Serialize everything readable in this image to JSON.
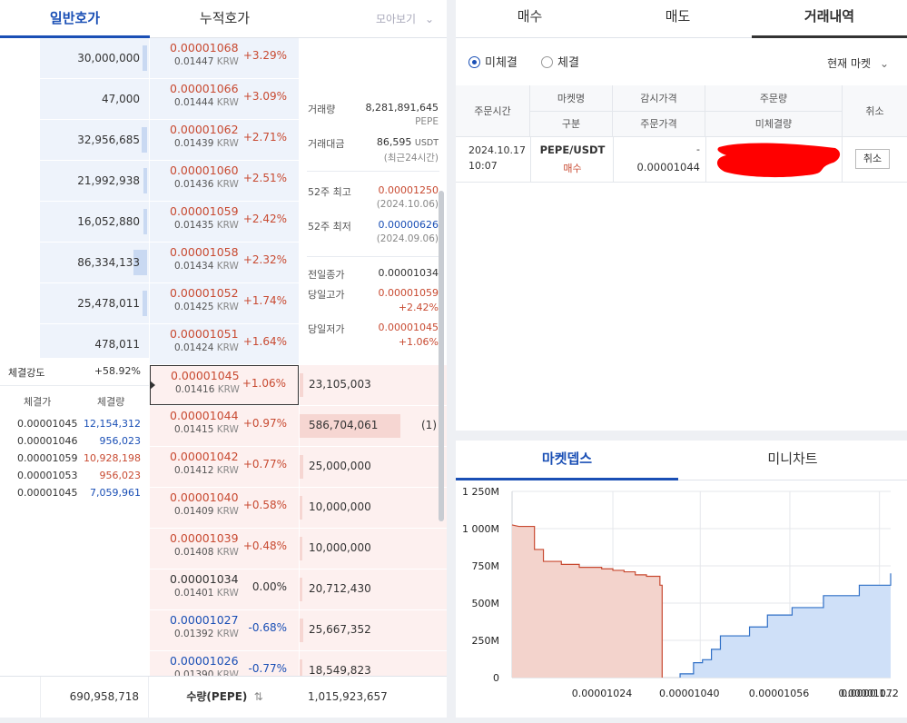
{
  "left_tabs": {
    "normal": "일반호가",
    "cumulative": "누적호가",
    "gather": "모아보기"
  },
  "asks": [
    {
      "vol": "30,000,000",
      "price": "0.00001068",
      "krw": "0.01447",
      "pct": "+3.29%",
      "bar": 0.04
    },
    {
      "vol": "47,000",
      "price": "0.00001066",
      "krw": "0.01444",
      "pct": "+3.09%",
      "bar": 0.0
    },
    {
      "vol": "32,956,685",
      "price": "0.00001062",
      "krw": "0.01439",
      "pct": "+2.71%",
      "bar": 0.05
    },
    {
      "vol": "21,992,938",
      "price": "0.00001060",
      "krw": "0.01436",
      "pct": "+2.51%",
      "bar": 0.03
    },
    {
      "vol": "16,052,880",
      "price": "0.00001059",
      "krw": "0.01435",
      "pct": "+2.42%",
      "bar": 0.03
    },
    {
      "vol": "86,334,133",
      "price": "0.00001058",
      "krw": "0.01434",
      "pct": "+2.32%",
      "bar": 0.13
    },
    {
      "vol": "25,478,011",
      "price": "0.00001052",
      "krw": "0.01425",
      "pct": "+1.74%",
      "bar": 0.04
    },
    {
      "vol": "478,011",
      "price": "0.00001051",
      "krw": "0.01424",
      "pct": "+1.64%",
      "bar": 0.0
    }
  ],
  "bids": [
    {
      "price": "0.00001045",
      "krw": "0.01416",
      "pct": "+1.06%",
      "vol": "23,105,003",
      "bar": 0.04,
      "color": "red",
      "mine": ""
    },
    {
      "price": "0.00001044",
      "krw": "0.01415",
      "pct": "+0.97%",
      "vol": "586,704,061",
      "bar": 1.0,
      "color": "red",
      "mine": "(1)"
    },
    {
      "price": "0.00001042",
      "krw": "0.01412",
      "pct": "+0.77%",
      "vol": "25,000,000",
      "bar": 0.04,
      "color": "red",
      "mine": ""
    },
    {
      "price": "0.00001040",
      "krw": "0.01409",
      "pct": "+0.58%",
      "vol": "10,000,000",
      "bar": 0.02,
      "color": "red",
      "mine": ""
    },
    {
      "price": "0.00001039",
      "krw": "0.01408",
      "pct": "+0.48%",
      "vol": "10,000,000",
      "bar": 0.02,
      "color": "red",
      "mine": ""
    },
    {
      "price": "0.00001034",
      "krw": "0.01401",
      "pct": "0.00%",
      "vol": "20,712,430",
      "bar": 0.03,
      "color": "dark",
      "mine": ""
    },
    {
      "price": "0.00001027",
      "krw": "0.01392",
      "pct": "-0.68%",
      "vol": "25,667,352",
      "bar": 0.04,
      "color": "blue",
      "mine": ""
    },
    {
      "price": "0.00001026",
      "krw": "0.01390",
      "pct": "-0.77%",
      "vol": "18,549,823",
      "bar": 0.03,
      "color": "blue",
      "mine": ""
    }
  ],
  "krw_unit": "KRW",
  "info": {
    "volume_label": "거래량",
    "volume": "8,281,891,645",
    "volume_unit": "PEPE",
    "amount_label": "거래대금",
    "amount": "86,595",
    "amount_unit": "USDT",
    "amount_note": "(최근24시간)",
    "high52_label": "52주 최고",
    "high52": "0.00001250",
    "high52_date": "(2024.10.06)",
    "low52_label": "52주 최저",
    "low52": "0.00000626",
    "low52_date": "(2024.09.06)",
    "prev_close_label": "전일종가",
    "prev_close": "0.00001034",
    "day_high_label": "당일고가",
    "day_high": "0.00001059",
    "day_high_pct": "+2.42%",
    "day_low_label": "당일저가",
    "day_low": "0.00001045",
    "day_low_pct": "+1.06%"
  },
  "trades": {
    "strength_label": "체결강도",
    "strength": "+58.92%",
    "price_header": "체결가",
    "qty_header": "체결량",
    "rows": [
      {
        "price": "0.00001045",
        "qty": "12,154,312",
        "color": "blue"
      },
      {
        "price": "0.00001046",
        "qty": "956,023",
        "color": "blue"
      },
      {
        "price": "0.00001059",
        "qty": "10,928,198",
        "color": "red"
      },
      {
        "price": "0.00001053",
        "qty": "956,023",
        "color": "red"
      },
      {
        "price": "0.00001045",
        "qty": "7,059,961",
        "color": "blue"
      }
    ]
  },
  "footer": {
    "ask_total": "690,958,718",
    "qty_label": "수량(PEPE)",
    "bid_total": "1,015,923,657"
  },
  "order_tabs": {
    "buy": "매수",
    "sell": "매도",
    "history": "거래내역"
  },
  "filters": {
    "unfilled": "미체결",
    "filled": "체결",
    "market": "현재 마켓"
  },
  "order_table": {
    "h_time": "주문시간",
    "h_market": "마켓명",
    "h_type": "구분",
    "h_watch": "감시가격",
    "h_price": "주문가격",
    "h_qty": "주문량",
    "h_unfilled": "미체결량",
    "h_cancel": "취소",
    "row": {
      "date": "2024.10.17",
      "time": "10:07",
      "market": "PEPE/USDT",
      "type": "매수",
      "watch": "-",
      "price": "0.00001044",
      "cancel": "취소"
    }
  },
  "bottom_tabs": {
    "depth": "마켓뎁스",
    "minichart": "미니차트"
  },
  "chart_data": {
    "type": "area",
    "y_ticks": [
      "1 250M",
      "1 000M",
      "750M",
      "500M",
      "250M",
      "0"
    ],
    "x_ticks": [
      "0.00001024",
      "0.00001040",
      "0.00001056",
      "0.00001072",
      "0.0000 1..."
    ],
    "ylim": [
      0,
      1250
    ],
    "bid_series": [
      [
        0,
        1025
      ],
      [
        0.03,
        1015
      ],
      [
        0.1,
        1015
      ],
      [
        0.1,
        860
      ],
      [
        0.14,
        860
      ],
      [
        0.14,
        780
      ],
      [
        0.22,
        780
      ],
      [
        0.22,
        760
      ],
      [
        0.3,
        760
      ],
      [
        0.3,
        740
      ],
      [
        0.4,
        740
      ],
      [
        0.4,
        730
      ],
      [
        0.45,
        730
      ],
      [
        0.45,
        720
      ],
      [
        0.5,
        720
      ],
      [
        0.5,
        710
      ],
      [
        0.55,
        710
      ],
      [
        0.55,
        690
      ],
      [
        0.6,
        690
      ],
      [
        0.6,
        680
      ],
      [
        0.66,
        680
      ],
      [
        0.66,
        620
      ],
      [
        0.67,
        620
      ],
      [
        0.67,
        0
      ]
    ],
    "ask_series": [
      [
        0.75,
        0
      ],
      [
        0.75,
        25
      ],
      [
        0.81,
        25
      ],
      [
        0.81,
        100
      ],
      [
        0.85,
        100
      ],
      [
        0.85,
        120
      ],
      [
        0.89,
        120
      ],
      [
        0.89,
        190
      ],
      [
        0.93,
        190
      ],
      [
        0.93,
        280
      ],
      [
        1.06,
        280
      ],
      [
        1.06,
        340
      ],
      [
        1.14,
        340
      ],
      [
        1.14,
        420
      ],
      [
        1.25,
        420
      ],
      [
        1.25,
        470
      ],
      [
        1.39,
        470
      ],
      [
        1.39,
        550
      ],
      [
        1.55,
        550
      ],
      [
        1.55,
        620
      ],
      [
        1.69,
        620
      ],
      [
        1.69,
        700
      ]
    ]
  }
}
